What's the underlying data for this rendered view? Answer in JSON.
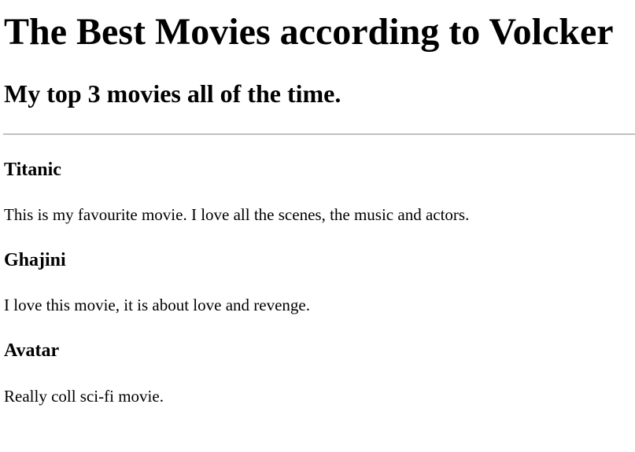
{
  "page": {
    "title": "The Best Movies according to Volcker",
    "subtitle": "My top 3 movies all of the time."
  },
  "movies": [
    {
      "title": "Titanic",
      "description": "This is my favourite movie. I love all the scenes, the music and actors."
    },
    {
      "title": "Ghajini",
      "description": "I love this movie, it is about love and revenge."
    },
    {
      "title": "Avatar",
      "description": "Really coll sci-fi movie."
    }
  ]
}
